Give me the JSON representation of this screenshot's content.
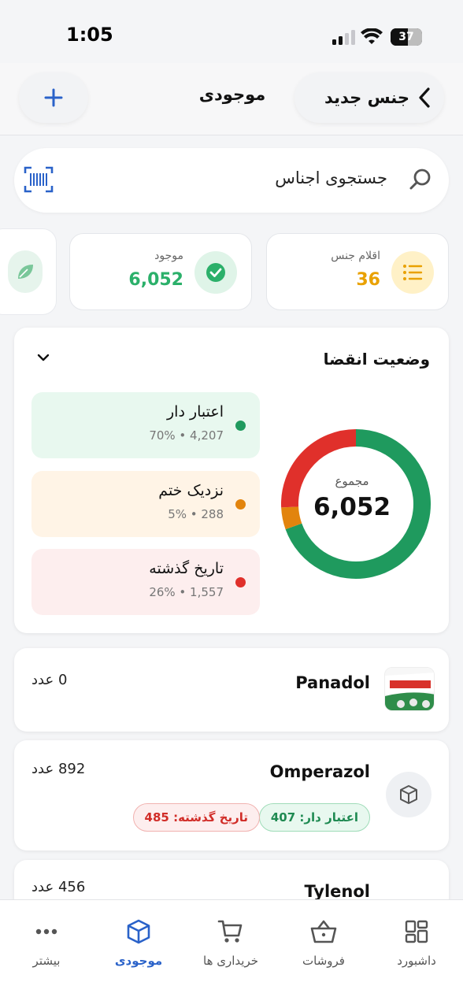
{
  "status_bar": {
    "time": "1:05",
    "battery": "37"
  },
  "header": {
    "title": "موجودی",
    "new_button_label": "جنس جدید",
    "add_icon": "plus-icon",
    "back_icon": "chevron-left-icon"
  },
  "search": {
    "placeholder": "جستجوی اجناس",
    "icon": "search-icon",
    "scan_icon": "barcode-scan-icon"
  },
  "stats": [
    {
      "label": "اقلام جنس",
      "value": "36",
      "icon": "list-icon",
      "color": "#e9a100"
    },
    {
      "label": "موجود",
      "value": "6,052",
      "icon": "check-circle-icon",
      "color": "#2bb06a"
    }
  ],
  "expiry": {
    "title": "وضعیت انقضا",
    "total_label": "مجموع",
    "total_value": "6,052",
    "items": [
      {
        "name": "اعتبار دار",
        "summary": "70% • 4,207",
        "value": 4207,
        "color": "#1f9a5e",
        "bg": "#e8f8ef"
      },
      {
        "name": "نزدیک ختم",
        "summary": "5% • 288",
        "value": 288,
        "color": "#e2840d",
        "bg": "#fff4e6"
      },
      {
        "name": "تاریخ گذشته",
        "summary": "26% • 1,557",
        "value": 1557,
        "color": "#e0302b",
        "bg": "#fdeeee"
      }
    ]
  },
  "products": [
    {
      "name": "Panadol",
      "qty": "0 عدد"
    },
    {
      "name": "Omperazol",
      "qty": "892 عدد",
      "valid_chip": "اعتبار دار: 407",
      "expired_chip": "تاریخ گذشته: 485"
    },
    {
      "name": "Tylenol",
      "qty": "456 عدد"
    }
  ],
  "nav": {
    "more": "بیشتر",
    "inventory": "موجودی",
    "purchases": "خریداری ها",
    "sales": "فروشات",
    "dashboard": "داشبورد"
  }
}
